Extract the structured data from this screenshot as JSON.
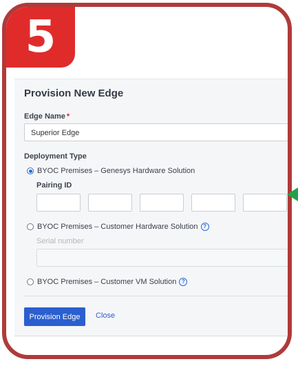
{
  "step": {
    "number": "5"
  },
  "form": {
    "title": "Provision New Edge",
    "edge_name_label": "Edge Name",
    "required_mark": "*",
    "edge_name_value": "Superior Edge",
    "deployment_type_label": "Deployment Type",
    "options": [
      {
        "label": "BYOC Premises – Genesys Hardware Solution",
        "selected": true
      },
      {
        "label": "BYOC Premises – Customer Hardware Solution",
        "selected": false
      },
      {
        "label": "BYOC Premises – Customer VM Solution",
        "selected": false
      }
    ],
    "pairing_id_label": "Pairing ID",
    "serial_number_label": "Serial number",
    "help_glyph": "?",
    "provision_button": "Provision Edge",
    "close_button": "Close"
  },
  "colors": {
    "frame": "#b03a3a",
    "badge": "#e02b2b",
    "primary": "#2b5fcf",
    "arrow": "#1fa34a"
  }
}
